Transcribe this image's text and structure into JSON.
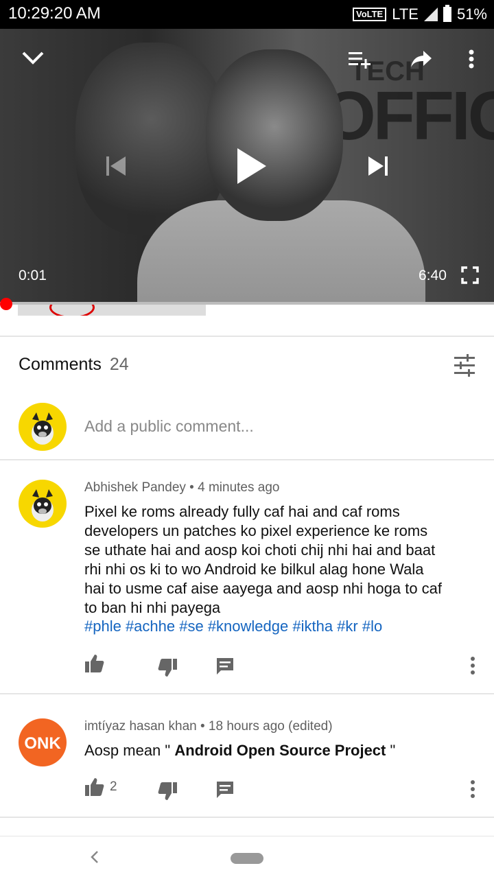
{
  "status_bar": {
    "time": "10:29:20 AM",
    "volte": "VoLTE",
    "network": "LTE",
    "battery": "51%"
  },
  "video": {
    "current_time": "0:01",
    "duration": "6:40",
    "progress": 0.003,
    "background_text": "OFFICE",
    "background_text_small": "TECH",
    "icons": [
      "chevron-down-icon",
      "add-to-queue-icon",
      "share-icon",
      "more-vert-icon",
      "previous-icon",
      "play-icon",
      "next-icon",
      "fullscreen-icon"
    ]
  },
  "comments": {
    "header_label": "Comments",
    "count": "24",
    "add_placeholder": "Add a public comment...",
    "items": [
      {
        "author": "Abhishek Pandey",
        "separator": "•",
        "time": "4 minutes ago",
        "text_lines": [
          "Pixel ke roms already fully caf hai and caf roms",
          "developers un patches ko pixel experience ke roms",
          "se uthate hai and aosp koi choti chij nhi hai and baat",
          "rhi nhi os ki to wo Android ke bilkul alag hone Wala",
          "hai to usme caf aise aayega and aosp nhi hoga to caf",
          "to ban hi nhi payega"
        ],
        "hashtags": "#phle #achhe #se #knowledge #iktha #kr #lo",
        "likes": ""
      },
      {
        "author": "imtíyaz hasan khan",
        "separator": "•",
        "time": "18 hours ago (edited)",
        "text_prefix": "Aosp mean \" ",
        "text_bold": "Android Open Source Project",
        "text_suffix": " \"",
        "likes": "2",
        "avatar_text": "ONK"
      }
    ]
  },
  "colors": {
    "accent_red": "#ff0000",
    "link_blue": "#1565c0",
    "avatar_yellow": "#f7d700",
    "avatar_orange": "#f26522"
  }
}
